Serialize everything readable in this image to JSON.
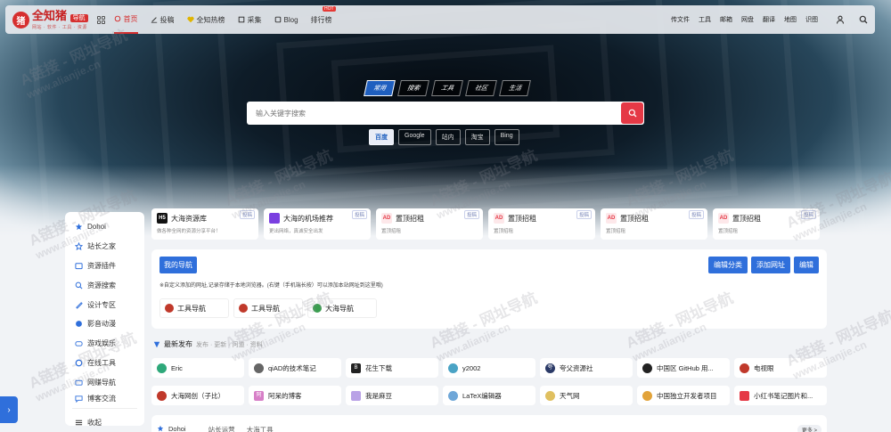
{
  "header": {
    "logo": "全知猪",
    "logo_badge": "导航",
    "logo_sub": "网站 · 软件 · 工具 · 资源",
    "nav": [
      {
        "label": "首页",
        "icon": "home-icon",
        "active": true
      },
      {
        "label": "投稿",
        "icon": "edit-icon"
      },
      {
        "label": "全知热榜",
        "icon": "heart-icon"
      },
      {
        "label": "采集",
        "icon": "collect-icon"
      },
      {
        "label": "Blog",
        "icon": "blog-icon"
      },
      {
        "label": "排行榜",
        "badge": "HOT"
      }
    ],
    "right_links": [
      "传文件",
      "工具",
      "邮箱",
      "网盘",
      "翻译",
      "地图",
      "识图"
    ]
  },
  "search": {
    "tabs": [
      "常用",
      "搜索",
      "工具",
      "社区",
      "生活"
    ],
    "active_tab": "常用",
    "placeholder": "输入关键字搜索",
    "engines": [
      "百度",
      "Google",
      "站内",
      "淘宝",
      "Bing"
    ],
    "active_engine": "百度"
  },
  "sidebar": {
    "items": [
      {
        "label": "Dohoi",
        "icon": "star-icon",
        "color": "#2f6fdb"
      },
      {
        "label": "站长之家",
        "icon": "star-outline-icon",
        "color": "#2f6fdb"
      },
      {
        "label": "资源插件",
        "icon": "folder-icon",
        "color": "#2f6fdb"
      },
      {
        "label": "资源搜索",
        "icon": "search-icon",
        "color": "#2f6fdb"
      },
      {
        "label": "设计专区",
        "icon": "pen-icon",
        "color": "#2f6fdb"
      },
      {
        "label": "影音动漫",
        "icon": "film-icon",
        "color": "#2f6fdb"
      },
      {
        "label": "游戏娱乐",
        "icon": "game-icon",
        "color": "#2f6fdb"
      },
      {
        "label": "在线工具",
        "icon": "tool-icon",
        "color": "#2f6fdb"
      },
      {
        "label": "网赚导航",
        "icon": "money-icon",
        "color": "#2f6fdb"
      },
      {
        "label": "博客交流",
        "icon": "chat-icon",
        "color": "#2f6fdb"
      }
    ],
    "collapse": "收起"
  },
  "cards": [
    {
      "title": "大海资源库",
      "desc": "做各种全网的资源分享平台！",
      "tag": "投稿",
      "icon_text": "H5",
      "icon_bg": "#111111",
      "icon_color": "#ffffff"
    },
    {
      "title": "大海的机场推荐",
      "desc": "更出网络，真诚安全出发",
      "tag": "投稿",
      "icon_text": "",
      "icon_bg": "#7a3fe0",
      "icon_color": "#ffffff"
    },
    {
      "title": "置顶招租",
      "desc": "置顶招租",
      "tag": "投稿",
      "icon_text": "AD",
      "icon_bg": "#fde8ea",
      "icon_color": "#e53946"
    },
    {
      "title": "置顶招租",
      "desc": "置顶招租",
      "tag": "投稿",
      "icon_text": "AD",
      "icon_bg": "#fde8ea",
      "icon_color": "#e53946"
    },
    {
      "title": "置顶招租",
      "desc": "置顶招租",
      "tag": "投稿",
      "icon_text": "AD",
      "icon_bg": "#fde8ea",
      "icon_color": "#e53946"
    },
    {
      "title": "置顶招租",
      "desc": "置顶招租",
      "tag": "投稿",
      "icon_text": "AD",
      "icon_bg": "#fde8ea",
      "icon_color": "#e53946"
    }
  ],
  "mynav": {
    "title": "我的导航",
    "buttons": [
      "编辑分类",
      "添加网址",
      "编辑"
    ],
    "note": "※自定义添加的网址,记录存储于本地浏览器。(右键（手机端长按）可以添加本站网址到这里哦)",
    "links": [
      {
        "label": "工具导航",
        "color": "#c0392b"
      },
      {
        "label": "工具导航",
        "color": "#c0392b"
      },
      {
        "label": "大海导航",
        "color": "#3a9e4f"
      }
    ]
  },
  "latest": {
    "title": "最新发布",
    "sub": "发布 · 更新 · 问道 · 资料"
  },
  "sites": [
    {
      "label": "Eric",
      "color": "#2ea87a",
      "glyph": ""
    },
    {
      "label": "qiAD的技术笔记",
      "color": "#666666",
      "glyph": ""
    },
    {
      "label": "花生下载",
      "color": "#222222",
      "glyph": "B"
    },
    {
      "label": "y2002",
      "color": "#4aa3c5",
      "glyph": ""
    },
    {
      "label": "夸父资源社",
      "color": "#2b3a67",
      "glyph": "夸"
    },
    {
      "label": "中国区 GitHub 用...",
      "color": "#222222",
      "glyph": ""
    },
    {
      "label": "电视眼",
      "color": "#c0392b",
      "glyph": ""
    },
    {
      "label": "大海网创（子比）",
      "color": "#c0392b",
      "glyph": ""
    },
    {
      "label": "阿呆的博客",
      "color": "#d77fc7",
      "glyph": "阿"
    },
    {
      "label": "我是麻豆",
      "color": "#b9a2e6",
      "glyph": ""
    },
    {
      "label": "LaTeX编辑器",
      "color": "#6fa7d8",
      "glyph": ""
    },
    {
      "label": "天气网",
      "color": "#e0c060",
      "glyph": ""
    },
    {
      "label": "中国独立开发者项目",
      "color": "#e2a33a",
      "glyph": ""
    },
    {
      "label": "小红书笔记图片和...",
      "color": "#e53946",
      "glyph": ""
    }
  ],
  "bottom": {
    "title": "Dohoi",
    "tabs": [
      "站长运营",
      "大海工具"
    ],
    "more": "更多 >"
  },
  "watermark": {
    "line1": "A链接 - 网址导航",
    "line2": "www.alianjie.cn"
  }
}
